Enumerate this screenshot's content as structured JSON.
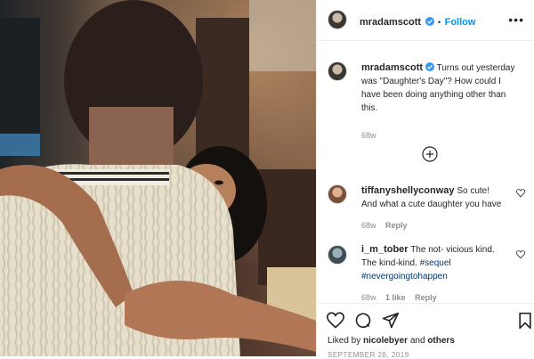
{
  "header": {
    "username": "mradamscott",
    "separator": "•",
    "follow_label": "Follow",
    "more_label": "•••",
    "avatar_icon": "profile-avatar",
    "verified_icon": "verified-badge-icon"
  },
  "caption": {
    "username": "mradamscott",
    "text": "Turns out yesterday was \"Daughter's Day\"? How could I have been doing anything other than this.",
    "time": "68w"
  },
  "load_more_icon": "plus-circle-icon",
  "comments": [
    {
      "username": "tiffanyshellyconway",
      "text": "So cute! And what a cute daughter you have",
      "time": "68w",
      "likes": "",
      "reply_label": "Reply"
    },
    {
      "username": "i_m_tober",
      "text": "The not- vicious kind. The kind-kind.",
      "tags": [
        "#sequel",
        "#nevergoingtohappen"
      ],
      "time": "68w",
      "likes": "1 like",
      "reply_label": "Reply"
    }
  ],
  "actions": {
    "like_icon": "heart-icon",
    "comment_icon": "comment-icon",
    "share_icon": "paper-plane-icon",
    "save_icon": "bookmark-icon"
  },
  "likes": {
    "prefix": "Liked by",
    "user": "nicolebyer",
    "connector": "and",
    "others": "others"
  },
  "date": "SEPTEMBER 28, 2019",
  "colors": {
    "accent": "#0095f6",
    "hashtag": "#00376b",
    "muted": "#8e8e8e",
    "text": "#262626",
    "border": "#efefef"
  }
}
